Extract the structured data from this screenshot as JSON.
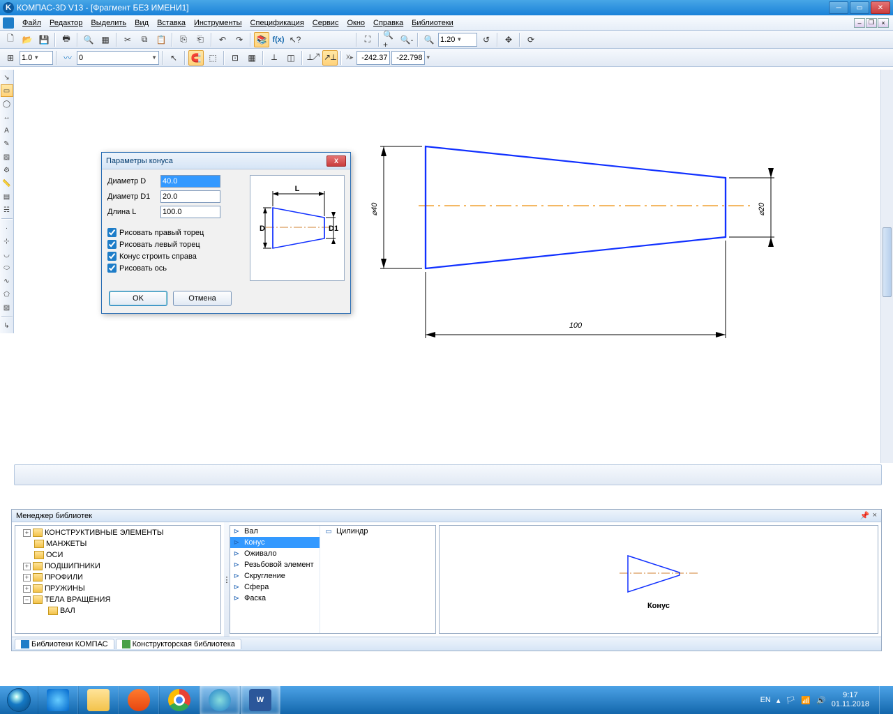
{
  "title": "КОМПАС-3D V13 - [Фрагмент БЕЗ ИМЕНИ1]",
  "menu": {
    "items": [
      "Файл",
      "Редактор",
      "Выделить",
      "Вид",
      "Вставка",
      "Инструменты",
      "Спецификация",
      "Сервис",
      "Окно",
      "Справка",
      "Библиотеки"
    ]
  },
  "toolbar2": {
    "scale": "1.0",
    "layer": "0",
    "coordX": "-242.37",
    "coordY": "-22.798"
  },
  "toolbar1": {
    "zoom": "1.20"
  },
  "dialog": {
    "title": "Параметры конуса",
    "fields": {
      "d_label": "Диаметр D",
      "d_value": "40.0",
      "d1_label": "Диаметр D1",
      "d1_value": "20.0",
      "l_label": "Длина L",
      "l_value": "100.0"
    },
    "checks": {
      "right_end": "Рисовать правый торец",
      "left_end": "Рисовать левый торец",
      "right_cone": "Конус строить справа",
      "axis": "Рисовать ось"
    },
    "preview": {
      "D": "D",
      "D1": "D1",
      "L": "L"
    },
    "ok": "OK",
    "cancel": "Отмена"
  },
  "drawing": {
    "dim_D": "⌀40",
    "dim_D1": "⌀20",
    "dim_L": "100"
  },
  "libmgr": {
    "title": "Менеджер библиотек",
    "tree": [
      {
        "label": "КОНСТРУКТИВНЫЕ ЭЛЕМЕНТЫ",
        "toggle": "+",
        "indent": 0
      },
      {
        "label": "МАНЖЕТЫ",
        "toggle": "",
        "indent": 0
      },
      {
        "label": "ОСИ",
        "toggle": "",
        "indent": 0
      },
      {
        "label": "ПОДШИПНИКИ",
        "toggle": "+",
        "indent": 0
      },
      {
        "label": "ПРОФИЛИ",
        "toggle": "+",
        "indent": 0
      },
      {
        "label": "ПРУЖИНЫ",
        "toggle": "+",
        "indent": 0
      },
      {
        "label": "ТЕЛА ВРАЩЕНИЯ",
        "toggle": "−",
        "indent": 0
      },
      {
        "label": "ВАЛ",
        "toggle": "",
        "indent": 1
      }
    ],
    "list_left": [
      "Вал",
      "Конус",
      "Оживало",
      "Резьбовой элемент",
      "Скругление",
      "Сфера",
      "Фаска"
    ],
    "list_right": [
      "Цилиндр"
    ],
    "selected": "Конус",
    "preview_label": "Конус",
    "tabs": [
      "Библиотеки КОМПАС",
      "Конструкторская библиотека"
    ]
  },
  "taskbar": {
    "lang": "EN",
    "time": "9:17",
    "date": "01.11.2018"
  }
}
